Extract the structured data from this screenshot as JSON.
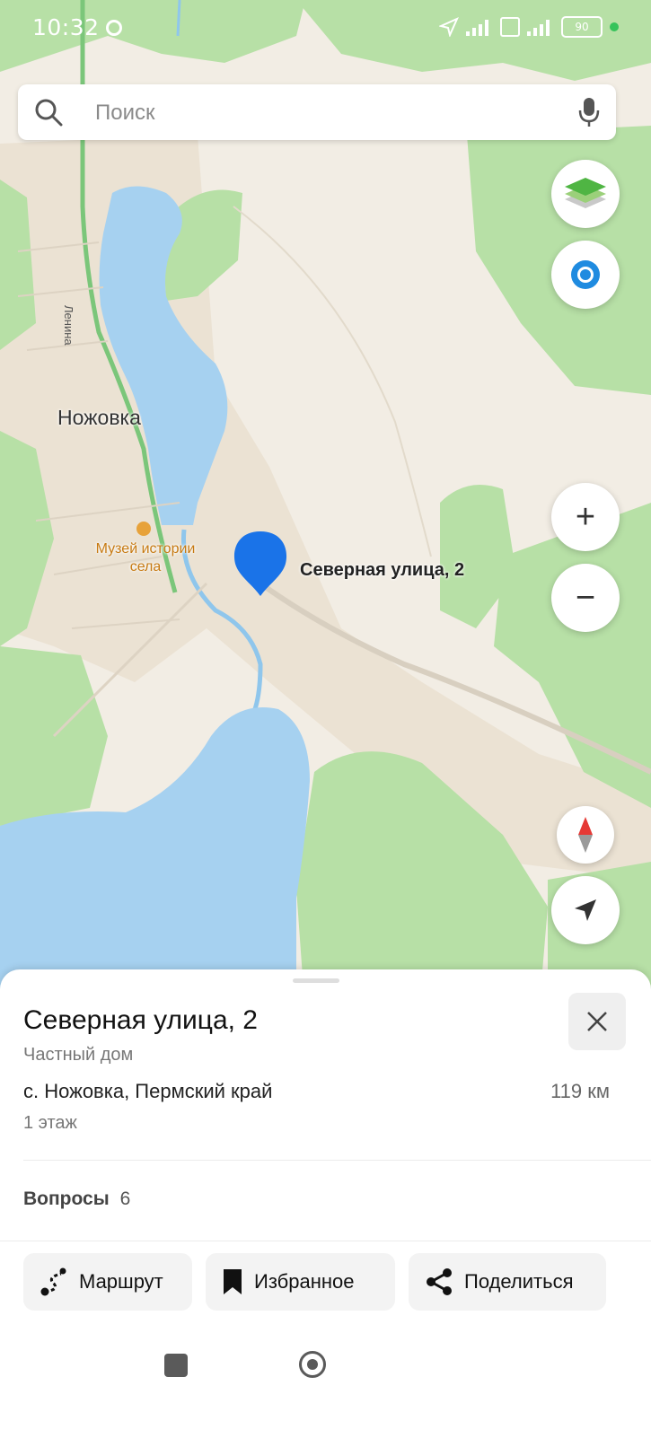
{
  "status_bar": {
    "time": "10:32",
    "battery": "90"
  },
  "search": {
    "placeholder": "Поиск"
  },
  "map": {
    "town_label": "Ножовка",
    "street_label": "Ленина",
    "poi_label": "Музей истории села",
    "pin_label": "Северная улица, 2",
    "colors": {
      "water": "#a6d1f0",
      "forest": "#b7e0a6",
      "land": "#f2ede4",
      "pin": "#1a73e8",
      "road": "#7bc67a"
    }
  },
  "map_controls": {
    "layers_icon": "layers-icon",
    "alice_icon": "voice-assistant-icon",
    "zoom_in": "+",
    "zoom_out": "−",
    "compass_icon": "compass-icon",
    "location_icon": "my-location-icon"
  },
  "place_card": {
    "title": "Северная улица, 2",
    "type": "Частный дом",
    "address": "с. Ножовка, Пермский край",
    "distance": "119 км",
    "floor": "1 этаж",
    "questions_label": "Вопросы",
    "questions_count": "6"
  },
  "actions": {
    "route": "Маршрут",
    "favorites": "Избранное",
    "share": "Поделиться"
  }
}
